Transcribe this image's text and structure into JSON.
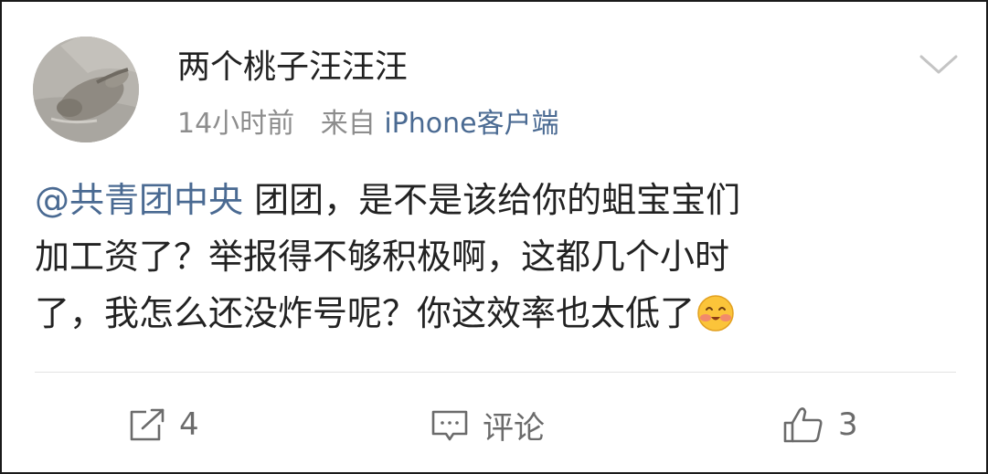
{
  "post": {
    "username": "两个桃子汪汪汪",
    "time": "14小时前",
    "source_prefix": "来自",
    "source": "iPhone客户端",
    "mention": "@共青团中央",
    "body_line1": " 团团，是不是该给你的蛆宝宝们",
    "body_line2": "加工资了？举报得不够积极啊，这都几个小时",
    "body_line3": "了，我怎么还没炸号呢？你这效率也太低了",
    "emoji": "blush-emoji"
  },
  "actions": {
    "repost_count": "4",
    "comment_label": "评论",
    "like_count": "3"
  },
  "colors": {
    "link": "#4a6a92",
    "text": "#222222",
    "meta": "#8d8d8d",
    "icon": "#6b6b6b"
  }
}
